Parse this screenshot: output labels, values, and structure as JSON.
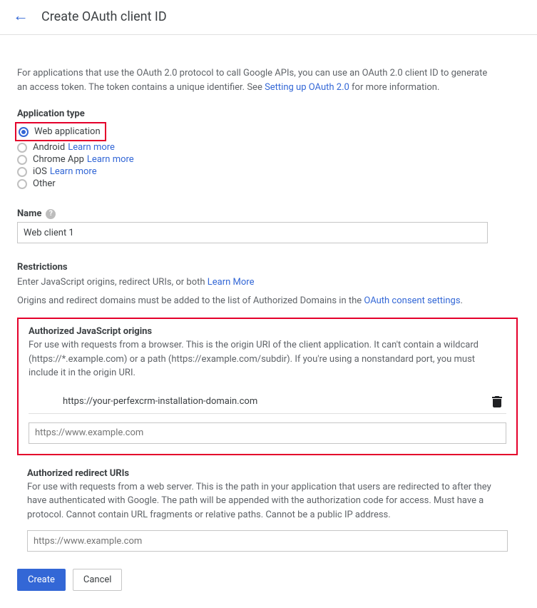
{
  "header": {
    "title": "Create OAuth client ID"
  },
  "intro": {
    "text_before": "For applications that use the OAuth 2.0 protocol to call Google APIs, you can use an OAuth 2.0 client ID to generate an access token. The token contains a unique identifier. See ",
    "link": "Setting up OAuth 2.0",
    "text_after": " for more information."
  },
  "app_type": {
    "label": "Application type",
    "options": [
      {
        "label": "Web application",
        "selected": true,
        "learn_more": ""
      },
      {
        "label": "Android",
        "selected": false,
        "learn_more": "Learn more"
      },
      {
        "label": "Chrome App",
        "selected": false,
        "learn_more": "Learn more"
      },
      {
        "label": "iOS",
        "selected": false,
        "learn_more": "Learn more"
      },
      {
        "label": "Other",
        "selected": false,
        "learn_more": ""
      }
    ]
  },
  "name": {
    "label": "Name",
    "value": "Web client 1"
  },
  "restrictions": {
    "heading": "Restrictions",
    "line1_before": "Enter JavaScript origins, redirect URIs, or both ",
    "line1_link": "Learn More",
    "line2_before": "Origins and redirect domains must be added to the list of Authorized Domains in the ",
    "line2_link": "OAuth consent settings",
    "line2_after": "."
  },
  "origins": {
    "title": "Authorized JavaScript origins",
    "description": "For use with requests from a browser. This is the origin URI of the client application. It can't contain a wildcard (https://*.example.com) or a path (https://example.com/subdir). If you're using a nonstandard port, you must include it in the origin URI.",
    "values": [
      "https://your-perfexcrm-installation-domain.com"
    ],
    "placeholder": "https://www.example.com"
  },
  "redirect": {
    "title": "Authorized redirect URIs",
    "description": "For use with requests from a web server. This is the path in your application that users are redirected to after they have authenticated with Google. The path will be appended with the authorization code for access. Must have a protocol. Cannot contain URL fragments or relative paths. Cannot be a public IP address.",
    "placeholder": "https://www.example.com"
  },
  "buttons": {
    "create": "Create",
    "cancel": "Cancel"
  }
}
